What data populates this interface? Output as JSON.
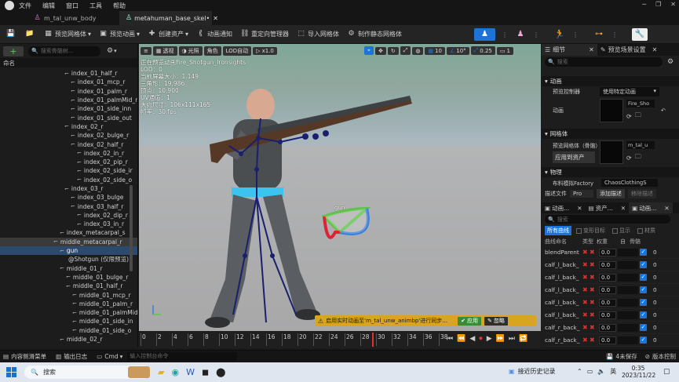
{
  "menu": [
    "文件",
    "编辑",
    "窗口",
    "工具",
    "帮助"
  ],
  "tabs": [
    {
      "label": "m_tal_unw_body"
    },
    {
      "label": "metahuman_base_skel•"
    }
  ],
  "toolbar": {
    "preview_mesh": "预览网格体",
    "preview_anim": "预览动画",
    "create_asset": "创建资产",
    "anim_notify": "动画通知",
    "retarget": "重定向管理器",
    "import_mesh": "导入网格体",
    "make_static": "制作静态网格体"
  },
  "left": {
    "search_placeholder": "搜索骨骼树...",
    "name_header": "命名",
    "tree": [
      "index_01_half_r",
      "index_01_mcp_r",
      "index_01_palm_r",
      "index_01_palmMid_r",
      "index_01_side_inn",
      "index_01_side_out",
      "index_02_r",
      "index_02_bulge_r",
      "index_02_half_r",
      "index_02_in_r",
      "index_02_pip_r",
      "index_02_side_ir",
      "index_02_side_o",
      "index_03_r",
      "index_03_bulge",
      "index_03_half_r",
      "index_02_dip_r",
      "index_03_in_r",
      "index_metacarpal_s",
      "middle_metacarpal_r",
      "gun",
      "@Shotgun (仅限预览)",
      "middle_01_r",
      "middle_01_bulge_r",
      "middle_01_half_r",
      "middle_01_mcp_r",
      "middle_01_palm_r",
      "middle_01_palmMid",
      "middle_01_side_in",
      "middle_01_side_o",
      "middle_02_r"
    ]
  },
  "viewport": {
    "perspective": "透视",
    "lit": "光照",
    "character": "角色",
    "lod": "LOD自动",
    "speed": "x1.0",
    "grid_value": "10",
    "angle_value": "10°",
    "scale_value": "0.25",
    "camera_value": "1",
    "info": [
      "正在预览动画Fire_Shotgun_Ironsights",
      "LOD：0",
      "当前屏幕大小：1.149",
      "三角形：19,986",
      "顶点：10,900",
      "UV通道：1",
      "大约尺寸：106x111x165",
      "帧率：30 fps"
    ],
    "gun_label": "gun",
    "notice": "启用实时动画至'm_tal_unw_animbp'进行同步...",
    "apply": "应用",
    "ignore": "忽略"
  },
  "timeline": {
    "ticks": [
      "0",
      "2",
      "4",
      "6",
      "8",
      "10",
      "12",
      "14",
      "16",
      "18",
      "20",
      "22",
      "24",
      "26",
      "28",
      "30",
      "32",
      "34",
      "36",
      "38"
    ]
  },
  "right": {
    "tab_details": "细节",
    "tab_scene": "预览场景设置",
    "search_placeholder": "搜索",
    "section_anim": "动画",
    "preview_controller_label": "预览控制器",
    "preview_controller_value": "使用特定动画",
    "anim_label": "动画",
    "anim_value": "Fire_Sho",
    "section_mesh": "网格体",
    "preview_mesh_label": "预览网格体（骨骼）",
    "mesh_value": "m_tal_u",
    "apply_to_asset": "应用到资产",
    "section_physics": "物理",
    "cloth_factory_label": "布料模拟Factory",
    "cloth_factory_value": "ChaosClothingS",
    "preset_label": "描述文件",
    "preset_value": "Pro",
    "add_preset": "添加描述",
    "remove_preset": "移除描述",
    "bottom_tabs": [
      "动画...",
      "资产...",
      "动画..."
    ],
    "curve_search": "搜索",
    "filters": [
      "所有曲线",
      "变形目标",
      "显示",
      "材质"
    ],
    "curve_headers": [
      "曲线命名",
      "类型",
      "权重",
      "自",
      "骨骼"
    ],
    "curves": [
      {
        "name": "blendParent",
        "weight": "0.0",
        "bones": "0"
      },
      {
        "name": "calf_l_back_",
        "weight": "0.0",
        "bones": "0"
      },
      {
        "name": "calf_l_back_",
        "weight": "0.0",
        "bones": "0"
      },
      {
        "name": "calf_l_back_",
        "weight": "0.0",
        "bones": "0"
      },
      {
        "name": "calf_l_back_",
        "weight": "0.0",
        "bones": "0"
      },
      {
        "name": "calf_l_back_",
        "weight": "0.0",
        "bones": "0"
      },
      {
        "name": "calf_r_back_",
        "weight": "0.0",
        "bones": "0"
      },
      {
        "name": "calf_r_back_",
        "weight": "0.0",
        "bones": "0"
      }
    ]
  },
  "status": {
    "content_drawer": "内容侧滑菜单",
    "output_log": "输出日志",
    "cmd": "Cmd",
    "cmd_placeholder": "输入控制台命令",
    "unsaved": "4未保存",
    "version": "版本控制"
  },
  "taskbar": {
    "search": "搜索",
    "recent": "接近历史记录",
    "time": "0:35",
    "date": "2023/11/22",
    "lang": "英"
  },
  "colors": {
    "accent": "#1d74d6",
    "apply_green": "#3a8a3a",
    "notice_bg": "#d9a520"
  }
}
